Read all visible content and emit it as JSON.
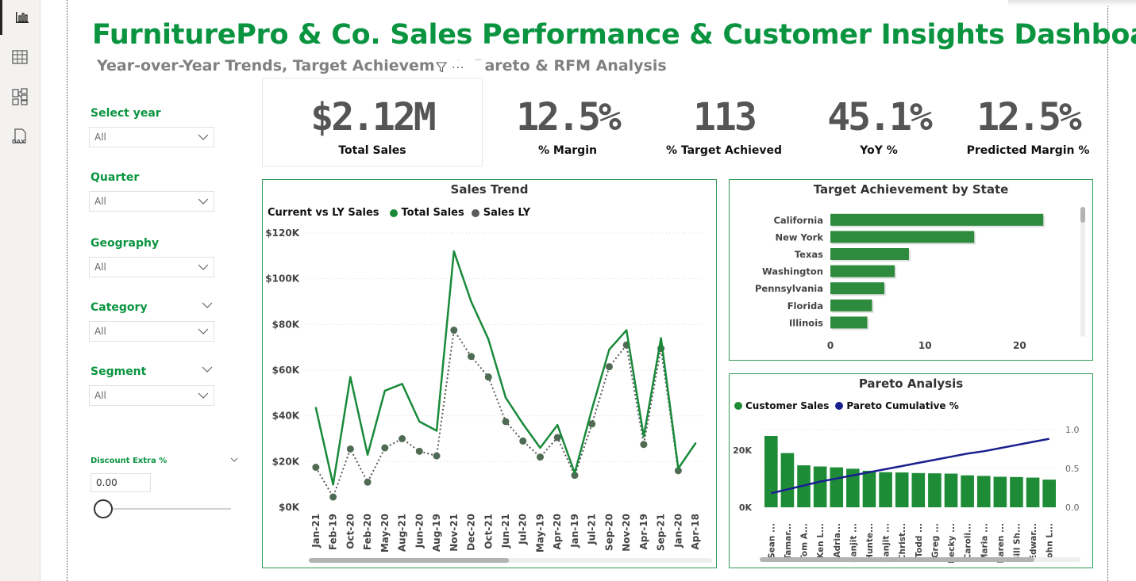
{
  "report": {
    "title": "FurniturePro & Co. Sales Performance & Customer Insights Dashboard",
    "subtitle": "Year-over-Year Trends, Target Achievement, Pareto & RFM Analysis"
  },
  "nav_icons": [
    "report-view-icon",
    "table-view-icon",
    "model-view-icon",
    "dax-query-icon"
  ],
  "filters": {
    "year": {
      "label": "Select year",
      "value": "All"
    },
    "quarter": {
      "label": "Quarter",
      "value": "All"
    },
    "geography": {
      "label": "Geography",
      "value": "All"
    },
    "category": {
      "label": "Category",
      "value": "All"
    },
    "segment": {
      "label": "Segment",
      "value": "All"
    },
    "discount": {
      "label": "Discount Extra %",
      "value": "0.00",
      "slider_fraction": 0
    }
  },
  "kpis": [
    {
      "value": "$2.12M",
      "label": "Total Sales"
    },
    {
      "value": "12.5%",
      "label": "% Margin"
    },
    {
      "value": "113",
      "label": "% Target Achieved"
    },
    {
      "value": "45.1%",
      "label": "YoY %"
    },
    {
      "value": "12.5%",
      "label": "Predicted Margin %"
    }
  ],
  "colors": {
    "accent": "#0a9440",
    "series_current": "#198a3a",
    "series_ly": "#5a5a5a",
    "pareto_line": "#1a1f8f",
    "bar": "#1e8c37"
  },
  "chart_data": [
    {
      "type": "line",
      "title": "Sales Trend",
      "legend_title": "Current vs LY Sales",
      "legend_position": "top-left",
      "categories": [
        "Jan-21",
        "Feb-19",
        "Oct-20",
        "Feb-20",
        "May-20",
        "Aug-21",
        "Jun-20",
        "Aug-19",
        "Nov-21",
        "Dec-20",
        "Oct-21",
        "Jun-21",
        "Jul-20",
        "May-19",
        "Apr-20",
        "Jan-19",
        "Jul-21",
        "Sep-20",
        "Nov-20",
        "Apr-19",
        "Sep-21",
        "Jan-20",
        "Apr-18"
      ],
      "series": [
        {
          "name": "Total Sales",
          "values": [
            43500,
            10000,
            57000,
            23000,
            51000,
            54000,
            37500,
            33500,
            112000,
            90000,
            73500,
            48000,
            36500,
            26000,
            36000,
            15000,
            43000,
            69000,
            77500,
            31000,
            74000,
            17000,
            28000
          ]
        },
        {
          "name": "Sales LY",
          "values": [
            17500,
            4500,
            25500,
            11000,
            26000,
            30000,
            24500,
            22500,
            77500,
            66000,
            57000,
            37500,
            29000,
            22000,
            30500,
            14000,
            36500,
            61500,
            71000,
            27500,
            69500,
            16000,
            null
          ]
        }
      ],
      "y_ticks": [
        "$0K",
        "$20K",
        "$40K",
        "$60K",
        "$80K",
        "$100K",
        "$120K"
      ],
      "ylim": [
        0,
        120000
      ],
      "grid": true
    },
    {
      "type": "bar",
      "orientation": "horizontal",
      "title": "Target Achievement by State",
      "categories": [
        "California",
        "New York",
        "Texas",
        "Washington",
        "Pennsylvania",
        "Florida",
        "Illinois"
      ],
      "values": [
        22.5,
        15.2,
        8.3,
        6.8,
        5.7,
        4.4,
        3.9
      ],
      "x_ticks": [
        "0",
        "10",
        "20"
      ],
      "xlim": [
        0,
        25
      ]
    },
    {
      "type": "bar",
      "title": "Pareto Analysis",
      "legend_position": "top-left",
      "categories": [
        "Sean ...",
        "Tamar...",
        "Tom A...",
        "Ken L...",
        "Adria...",
        "Sanjit ...",
        "Hunte...",
        "Sanjit ...",
        "Christ...",
        "Todd ...",
        "Greg ...",
        "Becky ...",
        "Caroli...",
        "Maria ...",
        "Karen ...",
        "Bill Sh...",
        "Edwar...",
        "John L..."
      ],
      "series": [
        {
          "name": "Customer Sales",
          "values": [
            25000,
            19000,
            14700,
            14300,
            14000,
            13500,
            12800,
            12300,
            12200,
            12000,
            11900,
            11800,
            11200,
            11000,
            10700,
            10600,
            10400,
            9700
          ]
        },
        {
          "name": "Pareto Cumulative %",
          "values": [
            0.18,
            0.23,
            0.28,
            0.33,
            0.37,
            0.41,
            0.45,
            0.49,
            0.53,
            0.57,
            0.61,
            0.65,
            0.69,
            0.72,
            0.76,
            0.8,
            0.84,
            0.88
          ]
        }
      ],
      "y_ticks": [
        "0K",
        "20K"
      ],
      "y2_ticks": [
        "0.0",
        "0.5",
        "1.0"
      ],
      "ylim": [
        0,
        30000
      ],
      "y2lim": [
        0,
        1.1
      ]
    }
  ]
}
